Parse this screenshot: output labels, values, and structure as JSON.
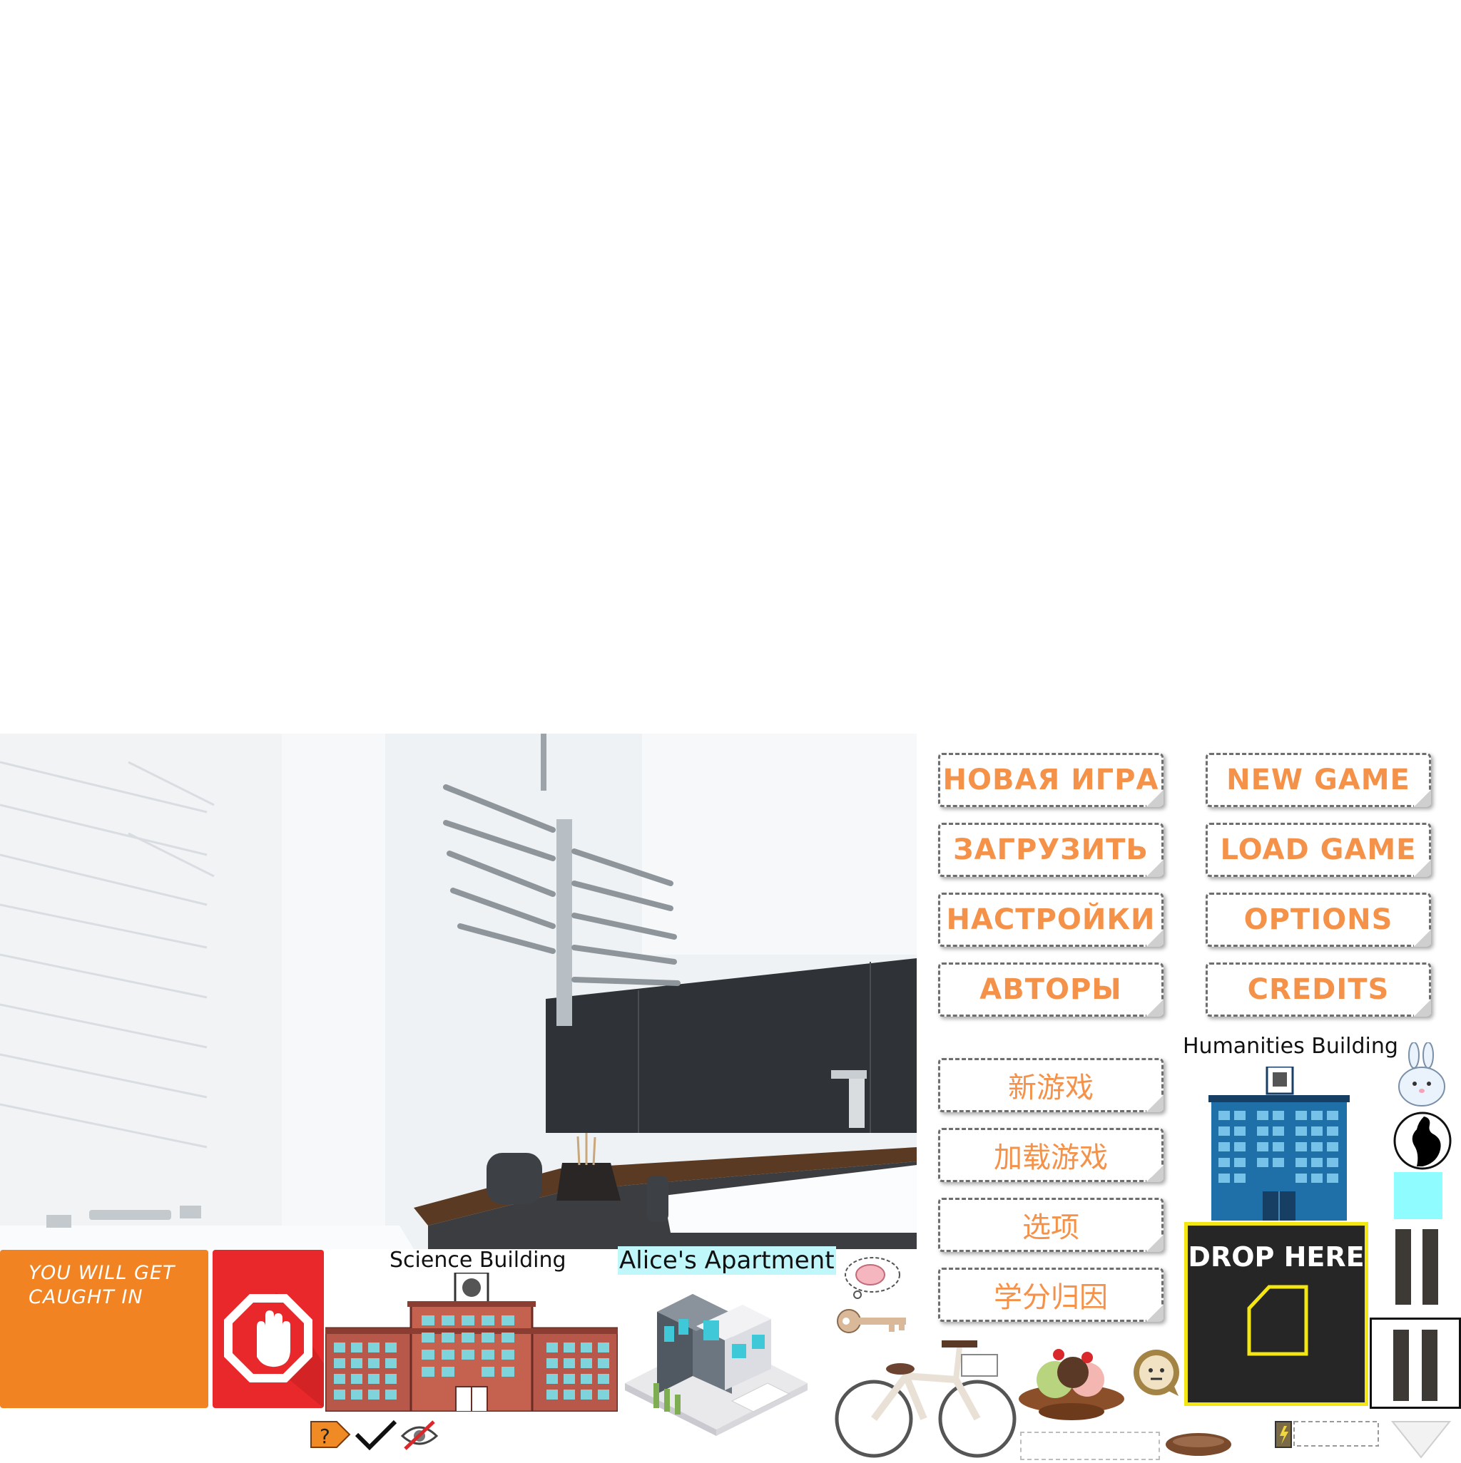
{
  "menu_ru": [
    "НОВАЯ ИГРА",
    "ЗАГРУЗИТЬ",
    "НАСТРОЙКИ",
    "АВТОРЫ"
  ],
  "menu_en": [
    "NEW GAME",
    "LOAD GAME",
    "OPTIONS",
    "CREDITS"
  ],
  "menu_cn": [
    "新游戏",
    "加载游戏",
    "选项",
    "学分归因"
  ],
  "labels": {
    "humanities": "Humanities Building",
    "science": "Science Building",
    "apartment": "Alice's Apartment",
    "drop_here": "DROP HERE",
    "caught": "YOU WILL GET CAUGHT IN"
  },
  "colors": {
    "button_text": "#f4924a",
    "orange_panel": "#f28322",
    "red_panel": "#e8282b",
    "drop_zone_bg": "#262626",
    "drop_zone_border": "#f2e614",
    "humanities_blue": "#1f6fa8",
    "science_red": "#b8584a",
    "cyan_swatch": "#8ffcff"
  },
  "icons": [
    "stop-hand-icon",
    "question-tag-icon",
    "checkmark-icon",
    "hidden-eye-icon",
    "brain-thought-icon",
    "key-icon",
    "bicycle-icon",
    "ice-cream-sundae-icon",
    "neutral-face-icon",
    "bunny-icon",
    "pregnant-silhouette-icon",
    "pause-icon",
    "battery-icon",
    "down-arrow-icon",
    "sausage-icon"
  ]
}
